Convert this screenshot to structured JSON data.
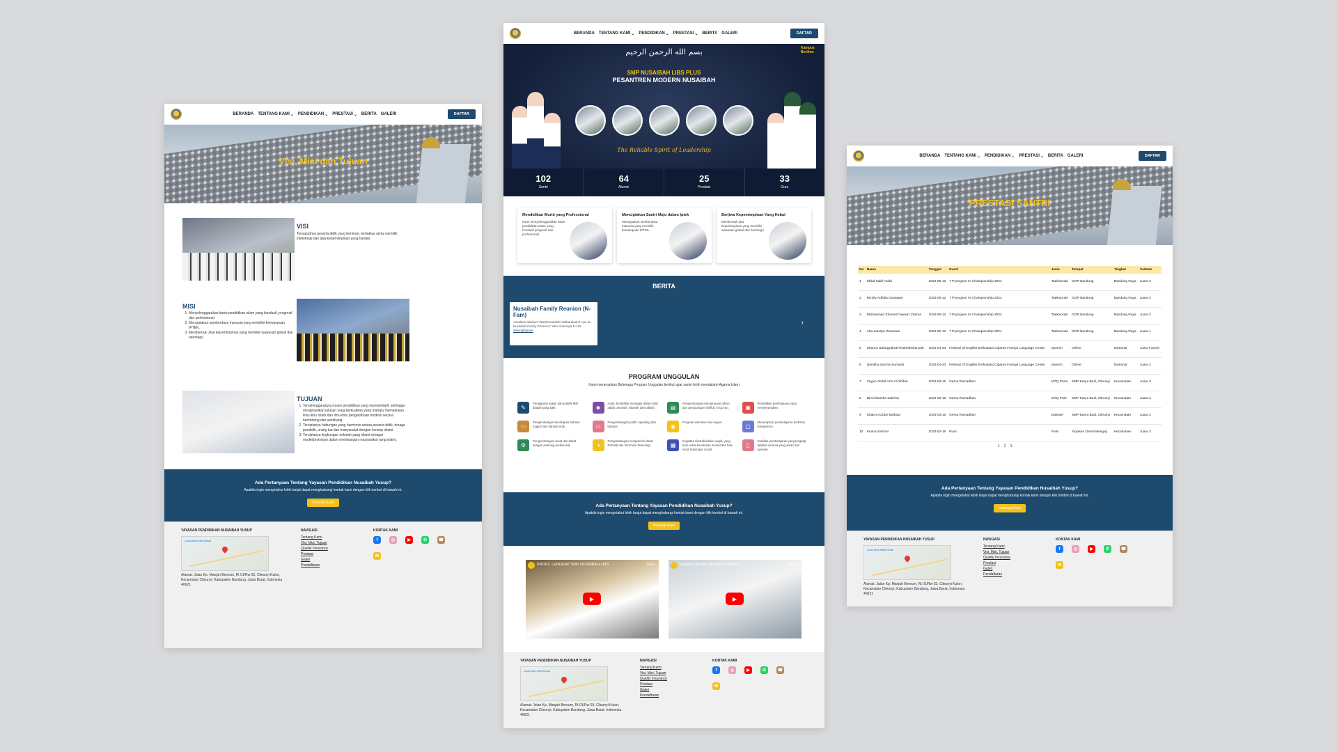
{
  "nav": {
    "items": [
      "BERANDA",
      "TENTANG KAMI",
      "PENDIDIKAN",
      "PRESTASI",
      "BERITA",
      "GALERI"
    ],
    "dropdown_flags": [
      false,
      true,
      true,
      true,
      false,
      false
    ],
    "cta": "DAFTAR"
  },
  "p1": {
    "hero_title": "Visi, Misi dan Tujuan",
    "visi_title": "VISI",
    "visi_text": "Terwujudnya peserta didik yang beriman, bertakwa serta memiliki intelektual dan jiwa kepemimpinan yang handal.",
    "misi_title": "MISI",
    "misi_items": [
      "Menyelenggarakan basis pendidikan islam yang kondusif, progresif dan professional.",
      "Menciptakan sumberdaya manusia yang memiliki kemampuan IPTEK.",
      "Membentuk Jiwa kepemimpinan yang memiliki wawasan global dan berintegri."
    ],
    "tujuan_title": "TUJUAN",
    "tujuan_items": [
      "Terselenggaranya proses pendidikan yang representatif, sehingga menghasilkan lulusan yang berkualitas yang mampu memadukan ilmu-ilmu Islam dan ilmu-ilmu pengetahuan modern secara berimbang dan seimbang.",
      "Terciptanya hubungan yang harmonis antara peserta didik, tenaga pendidik, orang tua dan masyarakat dengan konsep islami.",
      "Terciptanya lingkungan sekolah yang islami sebagai model/prototypo dalam membangun masyarakat yang islami."
    ]
  },
  "p2": {
    "calligraphy": "بسم الله الرحمن الرحيم",
    "school_name": "SMP NUSAIBAH LIBS PLUS",
    "pesantren": "PESANTREN MODERN NUSAIBAH",
    "badge": "Kampus Berilmu",
    "tagline": "The Reliable Spirit of Leadership",
    "stats": [
      {
        "value": "102",
        "label": "Santri"
      },
      {
        "value": "64",
        "label": "Alumni"
      },
      {
        "value": "25",
        "label": "Prestasi"
      },
      {
        "value": "33",
        "label": "Guru"
      }
    ],
    "cards": [
      {
        "title": "Mendidikan Murid yang Professional",
        "text": "Kami menyelenggarakan basis pendidikan Islam yang kondusif progresif dan professional"
      },
      {
        "title": "Menciptakan Santri Maju dalam Iptek",
        "text": "Menciptakan sumberdaya manusia yang memiliki kemampuan IPTEK."
      },
      {
        "title": "Berjiwa Kepemimpinan Yang Hebat",
        "text": "Membentuk jiwa kepemimpinan yang memiliki wawasan global dan berintegri"
      }
    ],
    "berita_title": "BERITA",
    "berita_head": "Nusaibah Family Reunion (N-Fam)",
    "berita_text": "Assalamu'alaikum Warahmatullahi Wabarakatuh Apa itu Nusaibah Family Reunion? Yaitu Keluarga N-LIB...",
    "berita_more": "Selengkapnya",
    "program_title": "PROGRAM UNGGULAN",
    "program_sub": "Kami menerapkan Beberapa Program Unggulan berikut agar santri lebih mendalami Agama Islam",
    "programs": [
      "Pengajaran kajian dan praktik fikih ibadah yang baik.",
      "Adab, berakhlak mengajar dalam sifat adabi, amanah, fatanah dan tabligh.",
      "Pengembangan kemampuan tahsin dan penguasaan Tahfidz Al Qur'an.",
      "Pendidikan pembiasaan yang menyenangkan.",
      "Pengembangan kecakapan bahasa Inggris dan bahasa arab.",
      "Pengembangan public speaking dan bahasa.",
      "Program intensive tuar negeri.",
      "Menerapkan pembelajaran berbasis kompetensi.",
      "Pengembangan minat dan bakat dengan psikolog profesional.",
      "Pengembangan kompetensi dasar Robotik dan Informasi Teknologi.",
      "Kegiatan ekstrakurikuler wajib, yang baik untuk kesehatan mental dan fisik serta hubungan sosial.",
      "Fasilitas pembelajaran yang lengkap, fasilitas asrama yang aman dan nyaman."
    ],
    "videos": [
      "PROFIL LENGKAP SMP NUSAIBAH LIBS",
      "Kegiatan Belajar Mengajar Mata Pe..."
    ],
    "video_share": "Share"
  },
  "p3": {
    "hero_title": "PRESTASI SANTRI",
    "headers": [
      "No",
      "Nama",
      "Tanggal",
      "Event",
      "Jenis",
      "Tempat",
      "Tingkat",
      "Catatan"
    ],
    "rows": [
      [
        "1",
        "Zhilal Sabil Arafa",
        "2024-05-12",
        "7 Pyongeon IV Championship 2024",
        "Taekwondo",
        "GOR Bandung",
        "Bandung Raya",
        "Juara 2"
      ],
      [
        "2",
        "Rizzky Adhitia Gunawan",
        "2024-05-12",
        "7 Pyongeon IV Championship 2024",
        "Taekwondo",
        "GOR Bandung",
        "Bandung Raya",
        "Juara 2"
      ],
      [
        "3",
        "Muhammad Shamel Fawwaz Zahran",
        "2024-05-12",
        "7 Pyongeon IV Championship 2024",
        "Taekwondo",
        "GOR Bandung",
        "Bandung Raya",
        "Juara 2"
      ],
      [
        "4",
        "Alta Sandya Ghassani",
        "2024-05-12",
        "7 Pyongeon IV Championship 2024",
        "Taekwondo",
        "GOR Bandung",
        "Bandung Raya",
        "Juara 1"
      ],
      [
        "5",
        "Shauny Bahagyahati Ihsanfatishanyah",
        "2024-04-20",
        "Festival Of English Enthusiast Ciparas Foreign Language Center",
        "Speech",
        "Online",
        "Nasional",
        "Juara Favorit"
      ],
      [
        "6",
        "Qoinsha Qurrira Sumardi",
        "2024-04-20",
        "Festival Of English Enthusiast Ciparas Foreign Language Center",
        "Speech",
        "Online",
        "Nasional",
        "Juara 2"
      ],
      [
        "7",
        "Zayyin Abdul Aziz Al-Ghifari",
        "2024-03-16",
        "Gema Ramadhan",
        "MTQ Putra",
        "SMP Karya Budi, Cileunyi",
        "Kecamatan",
        "Juara 3"
      ],
      [
        "8",
        "Dieni Marsha Sabrina",
        "2024-03-16",
        "Gema Ramadhan",
        "MTQ Putri",
        "SMP Karya Budi, Cileunyi",
        "Kecamatan",
        "Juara 2"
      ],
      [
        "9",
        "Khairul Azzam Baihaqi",
        "2024-03-16",
        "Gema Ramadhan",
        "Dakwah",
        "SMP Karya Budi, Cileunyi",
        "Kecamatan",
        "Juara 2"
      ],
      [
        "10",
        "Kirana Sari'ani",
        "2023-02-18",
        "Puisi",
        "Puisi",
        "Yayasan Gema Mengaji",
        "Kecamatan",
        "Juara 2"
      ]
    ],
    "pages": [
      "1",
      "2",
      "3"
    ]
  },
  "cta": {
    "question": "Ada Pertanyaan Tentang Yayasan Pendidikan Nusaibah Yusup?",
    "sub": "Apabila ingin mengetahui lebih lanjut dapat menghubungi kontak kami dengan klik tombol di bawah ini.",
    "button": "Hubungi Kami"
  },
  "footer": {
    "org": "YAYASAN PENDIDIKAN NUSAIBAH YUSUP",
    "map_label": "Lihat peta lebih besar",
    "address": "Alamat: Jalan Kp. Manjah Bereum, Rt 01/Rw 03, Cileunyi Kulon, Kecamatan Cileunyi, Kabupaten Bandung, Jawa Barat, Indonesia 40621",
    "nav_title": "NAVIGASI",
    "nav_links": [
      "Tentang Kami",
      "Visi, Misi, Tujuan",
      "Quality Insurance",
      "Prestasi",
      "Galeri",
      "Pendaftaran"
    ],
    "contact_title": "KONTAK KAMI",
    "contact_icons": [
      {
        "name": "facebook-icon",
        "color": "#1877f2",
        "glyph": "f"
      },
      {
        "name": "instagram-icon",
        "color": "#e8a0b4",
        "glyph": "◎"
      },
      {
        "name": "youtube-icon",
        "color": "#ff0000",
        "glyph": "▶"
      },
      {
        "name": "whatsapp-icon",
        "color": "#25d366",
        "glyph": "✆"
      },
      {
        "name": "phone-icon",
        "color": "#b08a5a",
        "glyph": "☎"
      },
      {
        "name": "email-icon",
        "color": "#f2c21b",
        "glyph": "✉"
      }
    ]
  },
  "colors": {
    "primary": "#1e4a6e",
    "accent": "#f2c21b",
    "page_bg": "#d9dadc"
  }
}
